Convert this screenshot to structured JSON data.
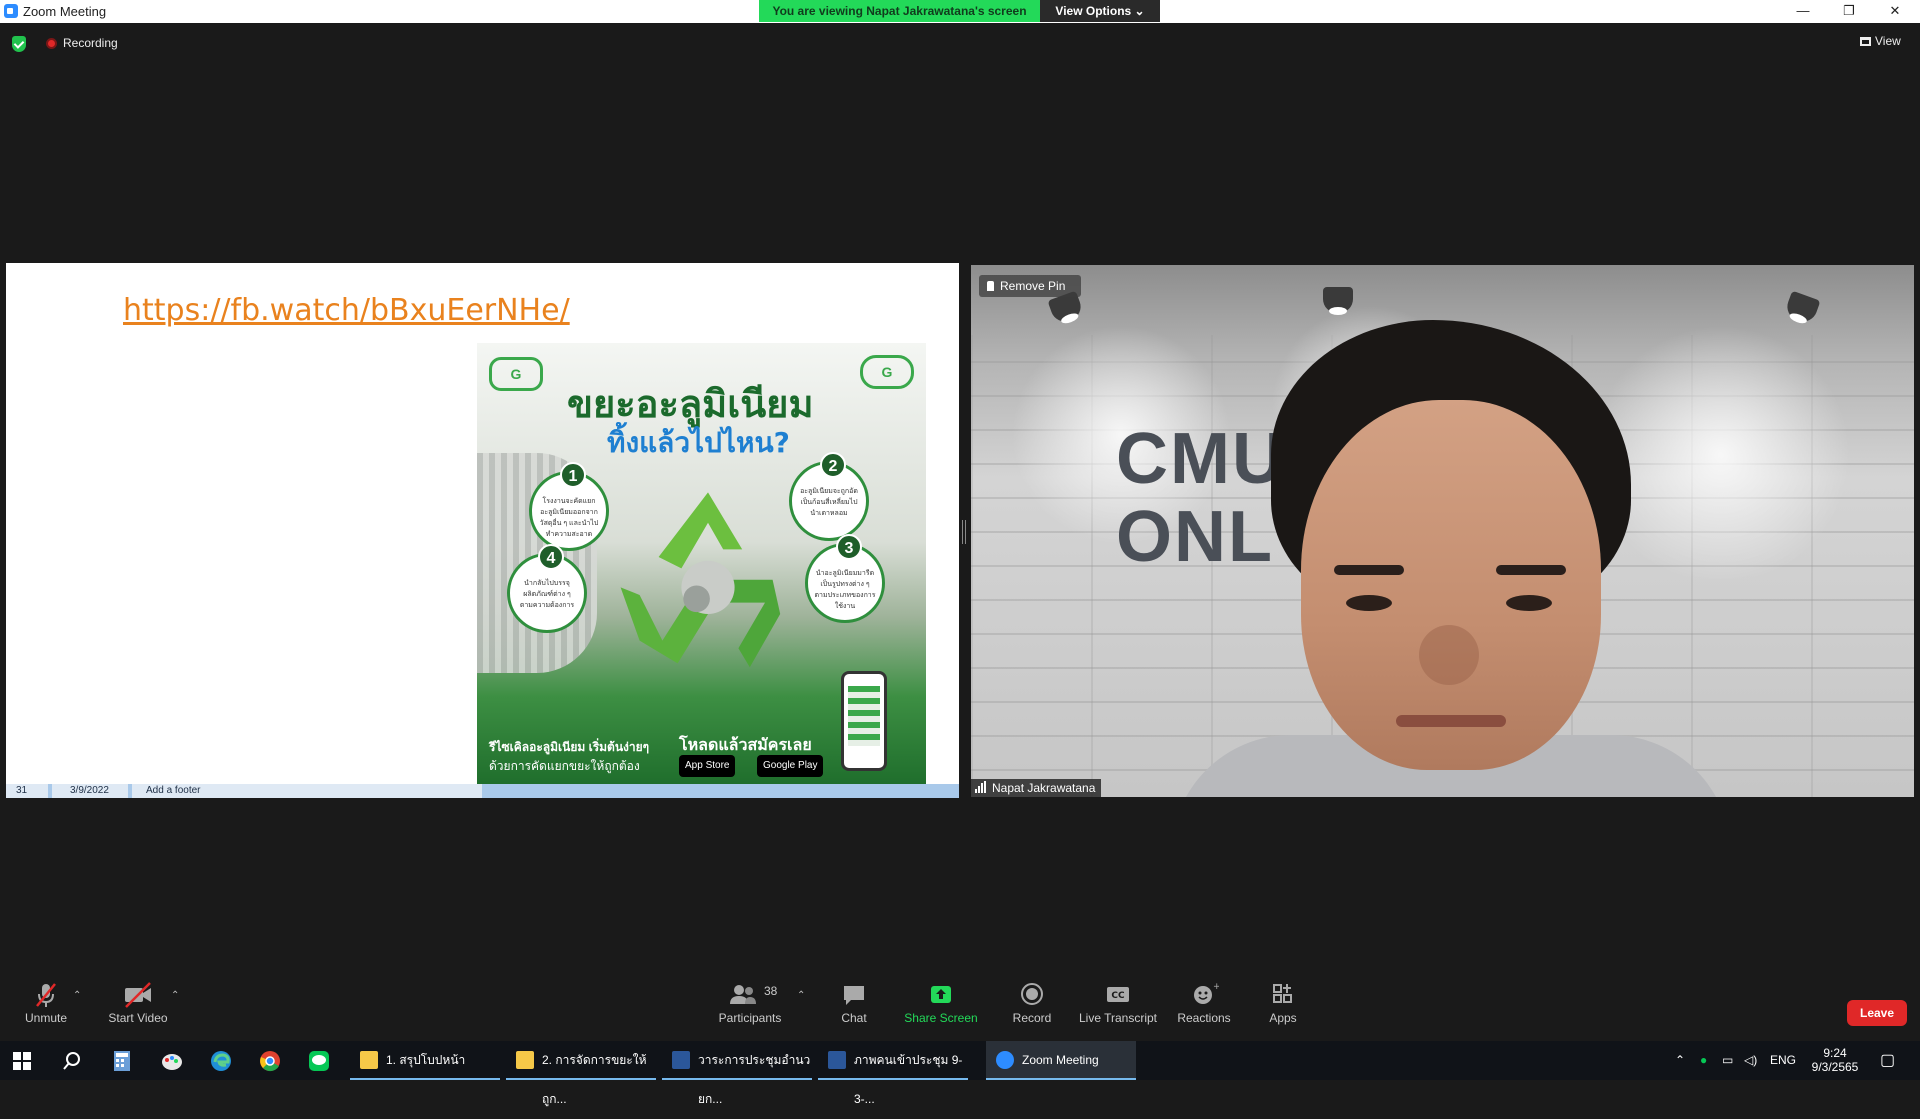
{
  "window": {
    "title": "Zoom Meeting",
    "viewing_banner": "You are viewing Napat Jakrawatana's screen",
    "view_options": "View Options ⌄",
    "controls": {
      "minimize": "—",
      "restore": "❐",
      "close": "✕"
    }
  },
  "status": {
    "recording_label": "Recording",
    "view_label": "View"
  },
  "shared_slide": {
    "link_text": "https://fb.watch/bBxuEerNHe/",
    "poster": {
      "headline": "ขยะอะลูมิเนียม",
      "subheadline": "ทิ้งแล้วไปไหน?",
      "logo_left": "G",
      "logo_right": "G",
      "steps": [
        {
          "num": "1",
          "text": "โรงงานจะคัดแยกอะลูมิเนียมออกจากวัสดุอื่น ๆ และนำไปทำความสะอาด"
        },
        {
          "num": "2",
          "text": "อะลูมิเนียมจะถูกอัดเป็นก้อนสี่เหลี่ยมไปนำเตาหลอม"
        },
        {
          "num": "3",
          "text": "นำอะลูมิเนียมมารีดเป็นรูปทรงต่าง ๆ ตามประเภทของการใช้งาน"
        },
        {
          "num": "4",
          "text": "นำกลับไปบรรจุผลิตภัณฑ์ต่าง ๆ ตามความต้องการ"
        }
      ],
      "footer_line1": "รีไซเคิลอะลูมิเนียม เริ่มต้นง่ายๆ",
      "footer_line2": "ด้วยการคัดแยกขยะให้ถูกต้อง",
      "download_text": "โหลดแล้วสมัครเลย",
      "app_store": "App Store",
      "google_play": "Google Play"
    },
    "footer": {
      "slide_number": "31",
      "date": "3/9/2022",
      "footer_text": "Add a footer"
    }
  },
  "video": {
    "remove_pin": "Remove Pin",
    "participant_name": "Napat Jakrawatana",
    "background_text_line1": "CMU",
    "background_text_line2": "ONL"
  },
  "toolbar": {
    "unmute": "Unmute",
    "start_video": "Start Video",
    "participants": "Participants",
    "participants_count": "38",
    "chat": "Chat",
    "share_screen": "Share Screen",
    "record": "Record",
    "live_transcript": "Live Transcript",
    "reactions": "Reactions",
    "apps": "Apps",
    "leave": "Leave",
    "share_color": "#23d959",
    "leave_color": "#e02828"
  },
  "taskbar": {
    "apps": [
      {
        "label": "1. สรุปโบปหน้า"
      },
      {
        "label": "2. การจัดการขยะให้ถูก..."
      },
      {
        "label": "วาระการประชุมอำนวยก..."
      },
      {
        "label": "ภาพคนเข้าประชุม 9-3-..."
      },
      {
        "label": "Zoom Meeting"
      }
    ],
    "language": "ENG",
    "time": "9:24",
    "date": "9/3/2565"
  }
}
